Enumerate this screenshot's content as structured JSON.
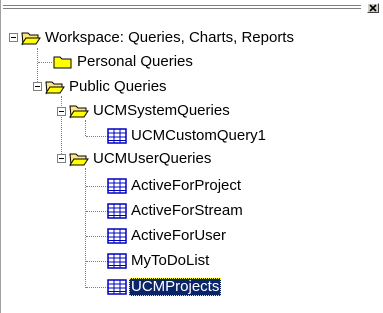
{
  "tree": {
    "root": {
      "label": "Workspace: Queries, Charts, Reports",
      "icon": "open-folder-icon"
    },
    "personal": {
      "label": "Personal Queries",
      "icon": "folder-icon"
    },
    "public": {
      "label": "Public Queries",
      "icon": "open-folder-icon"
    },
    "ucm_system": {
      "label": "UCMSystemQueries",
      "icon": "open-folder-icon"
    },
    "ucm_custom_query1": {
      "label": "UCMCustomQuery1",
      "icon": "query-grid-icon"
    },
    "ucm_user": {
      "label": "UCMUserQueries",
      "icon": "open-folder-icon"
    },
    "active_for_project": {
      "label": "ActiveForProject",
      "icon": "query-grid-icon"
    },
    "active_for_stream": {
      "label": "ActiveForStream",
      "icon": "query-grid-icon"
    },
    "active_for_user": {
      "label": "ActiveForUser",
      "icon": "query-grid-icon"
    },
    "my_todo_list": {
      "label": "MyToDoList",
      "icon": "query-grid-icon"
    },
    "ucm_projects": {
      "label": "UCMProjects",
      "icon": "query-grid-icon",
      "selected": true
    }
  },
  "colors": {
    "selection_bg": "#0a246a",
    "selection_fg": "#ffffff",
    "folder_fill": "#ffff00",
    "folder_open_fill": "#ffe680",
    "grid_blue": "#0000c0"
  }
}
